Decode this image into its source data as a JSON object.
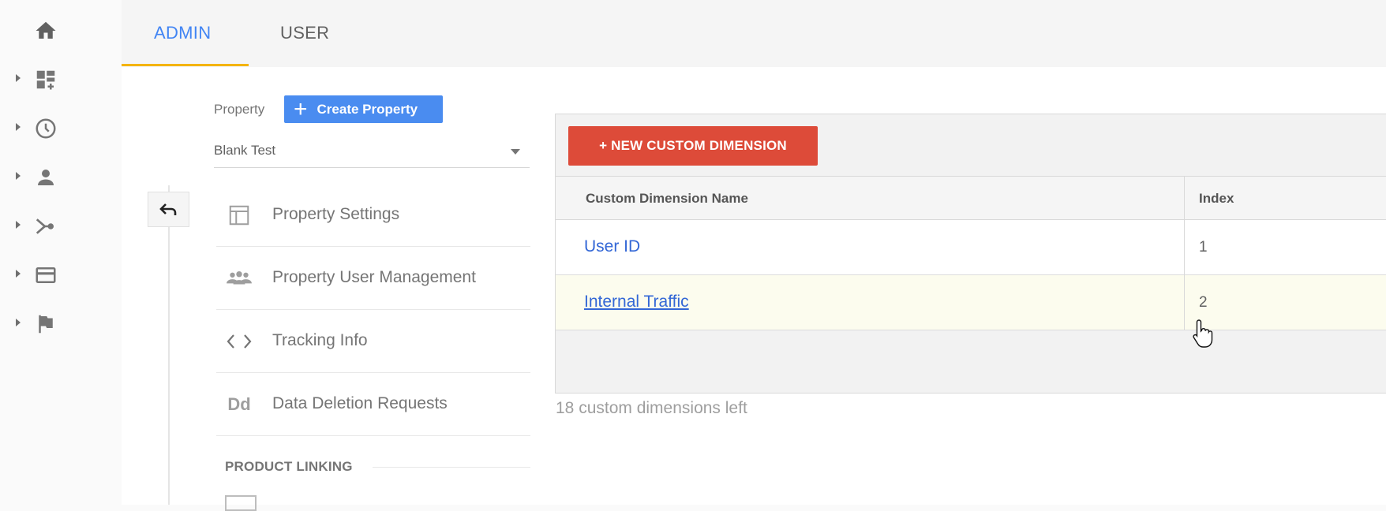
{
  "tabs": {
    "admin": "ADMIN",
    "user": "USER"
  },
  "property": {
    "label": "Property",
    "create_button": "Create Property",
    "selected": "Blank Test"
  },
  "nav": [
    {
      "label": "Property Settings",
      "icon": "property-settings-icon"
    },
    {
      "label": "Property User Management",
      "icon": "users-icon"
    },
    {
      "label": "Tracking Info",
      "icon": "code-icon"
    },
    {
      "label": "Data Deletion Requests",
      "icon": "dd-icon",
      "icon_text": "Dd"
    }
  ],
  "section": {
    "product_linking": "PRODUCT LINKING"
  },
  "dimensions": {
    "new_button": "+ NEW CUSTOM DIMENSION",
    "columns": {
      "name": "Custom Dimension Name",
      "index": "Index"
    },
    "rows": [
      {
        "name": "User ID",
        "index": "1"
      },
      {
        "name": "Internal Traffic",
        "index": "2"
      }
    ],
    "remaining": "18 custom dimensions left"
  },
  "colors": {
    "accent_blue": "#4285f4",
    "tab_indicator": "#f4b400",
    "new_button_red": "#dd4b39",
    "link_blue": "#3367d6"
  }
}
